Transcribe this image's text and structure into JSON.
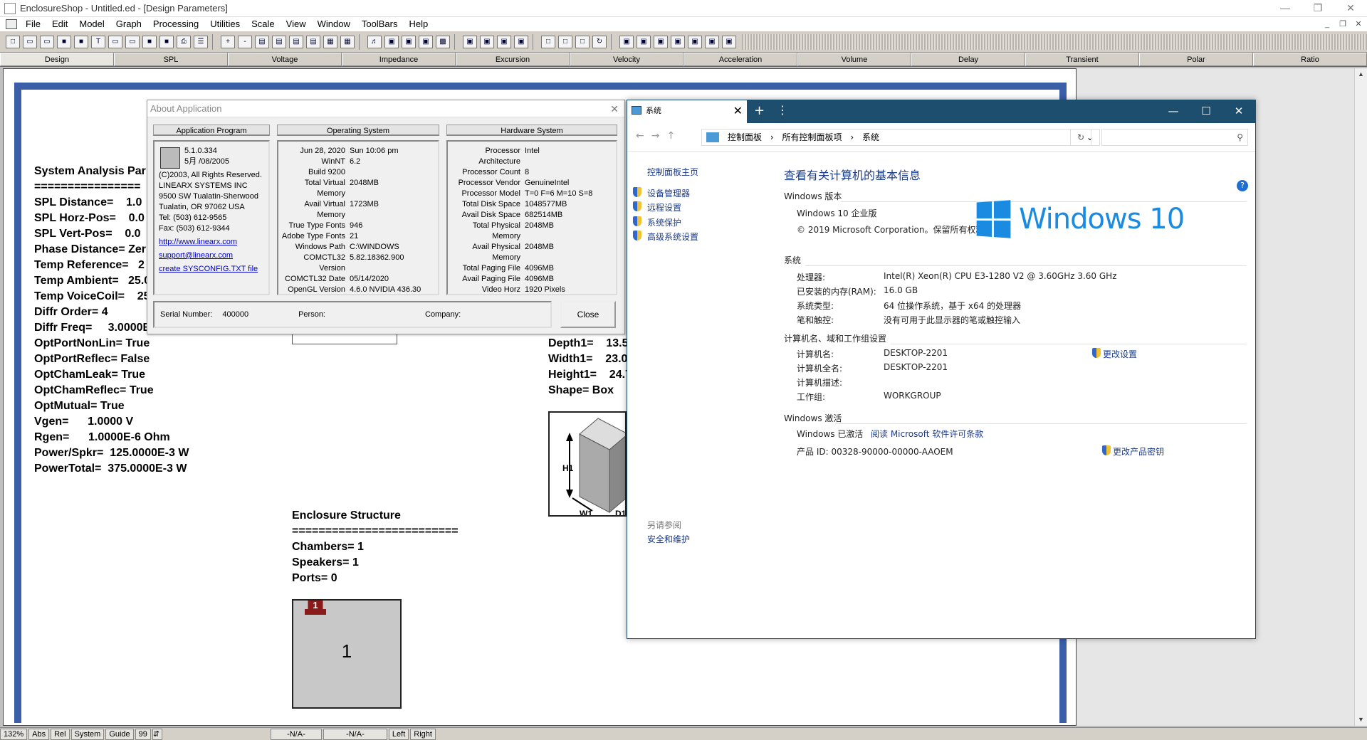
{
  "app": {
    "title": "EnclosureShop - Untitled.ed - [Design Parameters]",
    "menu": [
      "File",
      "Edit",
      "Model",
      "Graph",
      "Processing",
      "Utilities",
      "Scale",
      "View",
      "Window",
      "ToolBars",
      "Help"
    ],
    "tabs": [
      "Design",
      "SPL",
      "Voltage",
      "Impedance",
      "Excursion",
      "Velocity",
      "Acceleration",
      "Volume",
      "Delay",
      "Transient",
      "Polar",
      "Ratio"
    ],
    "active_tab": "Design"
  },
  "params": {
    "header": "System Analysis Par",
    "underline": "================",
    "lines": [
      "SPL Distance=    1.0",
      "SPL Horz-Pos=    0.0",
      "SPL Vert-Pos=    0.0",
      "Phase Distance= Zer",
      "Temp Reference=   2",
      "Temp Ambient=   25.0",
      "Temp VoiceCoil=    25",
      "Diffr Order= 4",
      "Diffr Freq=     3.0000E",
      "OptPortNonLin= True",
      "OptPortReflec= False",
      "OptChamLeak= True",
      "OptChamReflec= True",
      "OptMutual= True",
      "Vgen=      1.0000 V",
      "Rgen=      1.0000E-6 Ohm",
      "Power/Spkr=  125.0000E-3 W",
      "PowerTotal=  375.0000E-3 W"
    ],
    "box_lines": [
      "Depth1=    13.5",
      "Width1=    23.0",
      "Height1=    24.7",
      "Shape= Box"
    ],
    "box_labels": [
      "H1",
      "W1",
      "D1"
    ],
    "structure_title": "Enclosure Structure",
    "structure_underline": "=========================",
    "structure_lines": [
      "Chambers= 1",
      "Speakers= 1",
      "Ports= 0"
    ],
    "chamber_number": "1",
    "speaker_number": "1"
  },
  "about": {
    "title": "About Application",
    "groups": [
      "Application Program",
      "Operating System",
      "Hardware System"
    ],
    "app_lines": [
      "5.1.0.334",
      "5月 /08/2005",
      "(C)2003, All Rights Reserved.",
      "LINEARX SYSTEMS INC",
      "9500 SW Tualatin-Sherwood",
      "Tualatin, OR 97062 USA",
      "Tel: (503) 612-9565",
      "Fax: (503) 612-9344"
    ],
    "app_links": [
      "http://www.linearx.com",
      "support@linearx.com",
      "create SYSCONFIG.TXT file"
    ],
    "os_rows": [
      [
        "Jun 28, 2020",
        "Sun 10:06 pm"
      ],
      [
        "WinNT",
        "6.2"
      ],
      [
        "Build 9200",
        ""
      ],
      [
        "Total Virtual Memory",
        "2048MB"
      ],
      [
        "Avail Virtual Memory",
        "1723MB"
      ],
      [
        "True Type Fonts",
        "946"
      ],
      [
        "Adobe Type Fonts",
        "21"
      ],
      [
        "Windows Path",
        "C:\\WINDOWS"
      ],
      [
        "COMCTL32 Version",
        "5.82.18362.900"
      ],
      [
        "COMCTL32 Date",
        "05/14/2020"
      ],
      [
        "OpenGL Version",
        "4.6.0 NVIDIA 436.30"
      ],
      [
        "OpenGL Date",
        "10/07/2019"
      ],
      [
        "File System",
        "NTFS"
      ]
    ],
    "hw_rows": [
      [
        "Processor Architecture",
        "Intel"
      ],
      [
        "Processor Count",
        "8"
      ],
      [
        "Processor Vendor",
        "GenuineIntel"
      ],
      [
        "Processor Model",
        "T=0 F=6 M=10 S=8"
      ],
      [
        "Total Disk Space",
        "1048577MB"
      ],
      [
        "Avail Disk Space",
        "682514MB"
      ],
      [
        "Total Physical Memory",
        "2048MB"
      ],
      [
        "Avail Physical Memory",
        "2048MB"
      ],
      [
        "Total Paging File",
        "4096MB"
      ],
      [
        "Avail Paging File",
        "4096MB"
      ],
      [
        "Video Horz",
        "1920 Pixels"
      ],
      [
        "Video Vert",
        "1080 Pixels"
      ],
      [
        "Video Colors",
        "32 Bits"
      ]
    ],
    "serial_label": "Serial Number:",
    "serial_value": "400000",
    "person_label": "Person:",
    "company_label": "Company:",
    "close_label": "Close"
  },
  "sys": {
    "tab_title": "系统",
    "breadcrumb": [
      "控制面板",
      "所有控制面板项",
      "系统"
    ],
    "left_home": "控制面板主页",
    "left_links": [
      "设备管理器",
      "远程设置",
      "系统保护",
      "高级系统设置"
    ],
    "see_also": "另请参阅",
    "see_also_link": "安全和维护",
    "heading": "查看有关计算机的基本信息",
    "edition_section": "Windows 版本",
    "edition": "Windows 10 企业版",
    "copyright": "© 2019 Microsoft Corporation。保留所有权利。",
    "logo_text": "Windows 10",
    "system_section": "系统",
    "system_rows": [
      [
        "处理器:",
        "Intel(R) Xeon(R) CPU E3-1280 V2 @ 3.60GHz   3.60 GHz"
      ],
      [
        "已安装的内存(RAM):",
        "16.0 GB"
      ],
      [
        "系统类型:",
        "64 位操作系统，基于 x64 的处理器"
      ],
      [
        "笔和触控:",
        "没有可用于此显示器的笔或触控输入"
      ]
    ],
    "name_section": "计算机名、域和工作组设置",
    "name_rows": [
      [
        "计算机名:",
        "DESKTOP-2201"
      ],
      [
        "计算机全名:",
        "DESKTOP-2201"
      ],
      [
        "计算机描述:",
        ""
      ],
      [
        "工作组:",
        "WORKGROUP"
      ]
    ],
    "change_settings": "更改设置",
    "activation_section": "Windows 激活",
    "activated": "Windows 已激活",
    "license_link": "阅读 Microsoft 软件许可条款",
    "product_id": "产品 ID: 00328-90000-00000-AAOEM",
    "change_key": "更改产品密钥"
  },
  "status": {
    "zoom": "132%",
    "abs": "Abs",
    "rel": "Rel",
    "system": "System",
    "guide": "Guide",
    "num": "99",
    "na1": "-N/A-",
    "na2": "-N/A-",
    "left": "Left",
    "right": "Right"
  }
}
